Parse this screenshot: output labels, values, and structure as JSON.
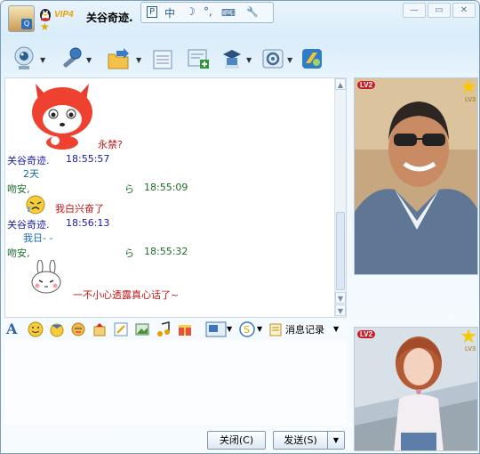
{
  "titlebar": {
    "badge": "VIP4",
    "contact_name": "关谷奇迹.",
    "status_icons": [
      "P",
      "中",
      "☽",
      "°,",
      "⌨",
      "🔧"
    ]
  },
  "window_buttons": {
    "minimize": "—",
    "maximize": "▭",
    "close": "✕"
  },
  "toolbar": {
    "icons": [
      "webcam-icon",
      "microphone-icon",
      "send-file-icon",
      "email-icon",
      "add-to-group-icon",
      "remote-assist-icon",
      "app-center-icon",
      "qzone-icon"
    ]
  },
  "chat": {
    "messages": [
      {
        "kind": "emoticon",
        "name": "red-fox-emoticon"
      },
      {
        "kind": "text",
        "text": "永禁?",
        "color": "red"
      },
      {
        "kind": "header",
        "name": "关谷奇迹.",
        "time": "18:55:57"
      },
      {
        "kind": "text",
        "text": "2天",
        "color": "blue"
      },
      {
        "kind": "header",
        "name": "吻安,",
        "name2": "ら",
        "time": "18:55:09"
      },
      {
        "kind": "text",
        "text": "我白兴奋了",
        "color": "red"
      },
      {
        "kind": "header",
        "name": "关谷奇迹.",
        "time": "18:56:13"
      },
      {
        "kind": "text",
        "text": "我日- -",
        "color": "blue"
      },
      {
        "kind": "header",
        "name": "吻安,",
        "name2": "ら",
        "time": "18:55:32"
      },
      {
        "kind": "text",
        "text": "一不小心透露真心话了~",
        "color": "red"
      }
    ]
  },
  "format_toolbar": {
    "history_label": "消息记录"
  },
  "buttons": {
    "close_label": "关闭(C)",
    "send_label": "发送(S)"
  },
  "profile_top": {
    "level": "LV2",
    "level_star": "LV3"
  },
  "profile_bottom": {
    "level": "LV2",
    "level_star": "LV3"
  }
}
